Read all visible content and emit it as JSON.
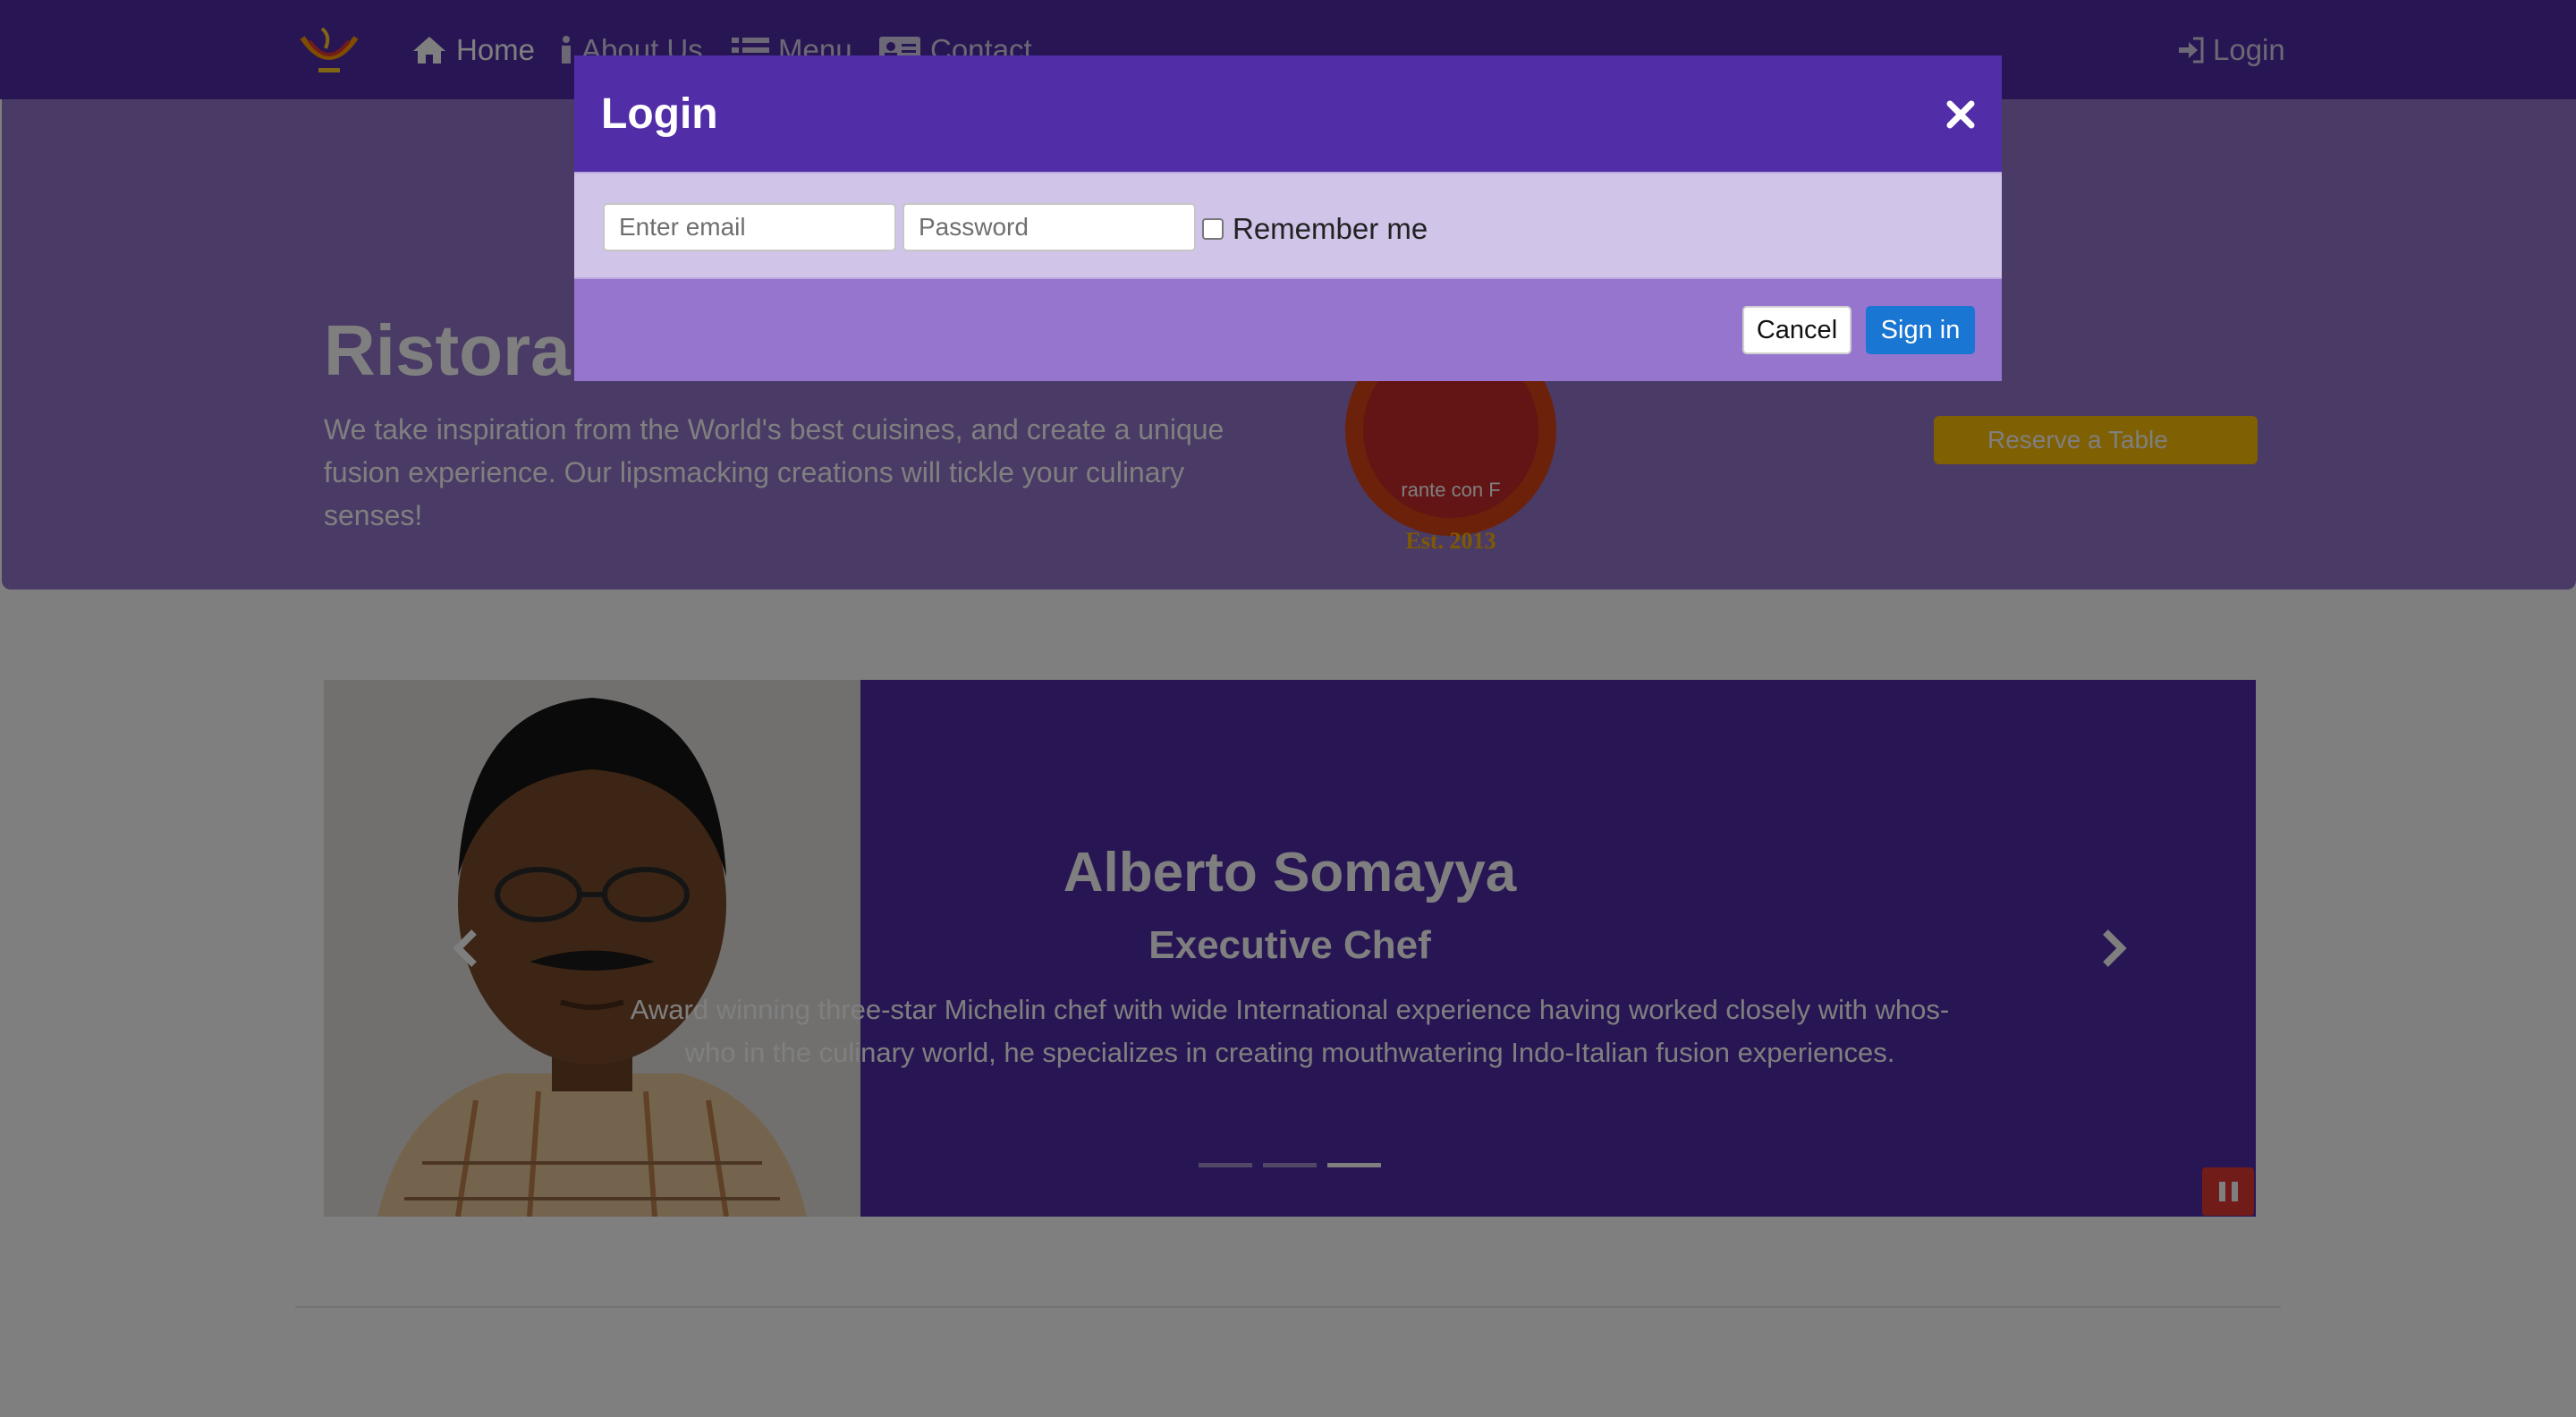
{
  "nav": {
    "home": "Home",
    "about": "About Us",
    "menu": "Menu",
    "contact": "Contact",
    "login": "Login"
  },
  "jumbotron": {
    "title": "Ristorante con Fusion",
    "description": "We take inspiration from the World's best cuisines, and create a unique fusion experience. Our lipsmacking creations will tickle your culinary senses!",
    "reserve_label": "Reserve a Table"
  },
  "carousel": {
    "name": "Alberto Somayya",
    "designation": "Executive Chef",
    "description": "Award winning three-star Michelin chef with wide International experience having worked closely with whos-who in the culinary world, he specializes in creating mouthwatering Indo-Italian fusion experiences.",
    "active_slide": 3,
    "slide_count": 3
  },
  "modal": {
    "title": "Login",
    "email_placeholder": "Enter email",
    "password_placeholder": "Password",
    "remember_label": "Remember me",
    "remember_checked": false,
    "cancel_label": "Cancel",
    "signin_label": "Sign in"
  },
  "colors": {
    "primary": "#512DA8",
    "primary_light": "#9575CD",
    "modal_body": "#D1C4E9",
    "reserve": "#FFC107",
    "signin": "#1976D2",
    "pause": "#E53935"
  },
  "icons": {
    "home": "home-icon",
    "about": "info-icon",
    "menu": "list-icon",
    "contact": "address-card-icon",
    "login": "sign-in-icon",
    "close": "close-icon",
    "prev": "chevron-left-icon",
    "next": "chevron-right-icon",
    "pause": "pause-icon"
  }
}
